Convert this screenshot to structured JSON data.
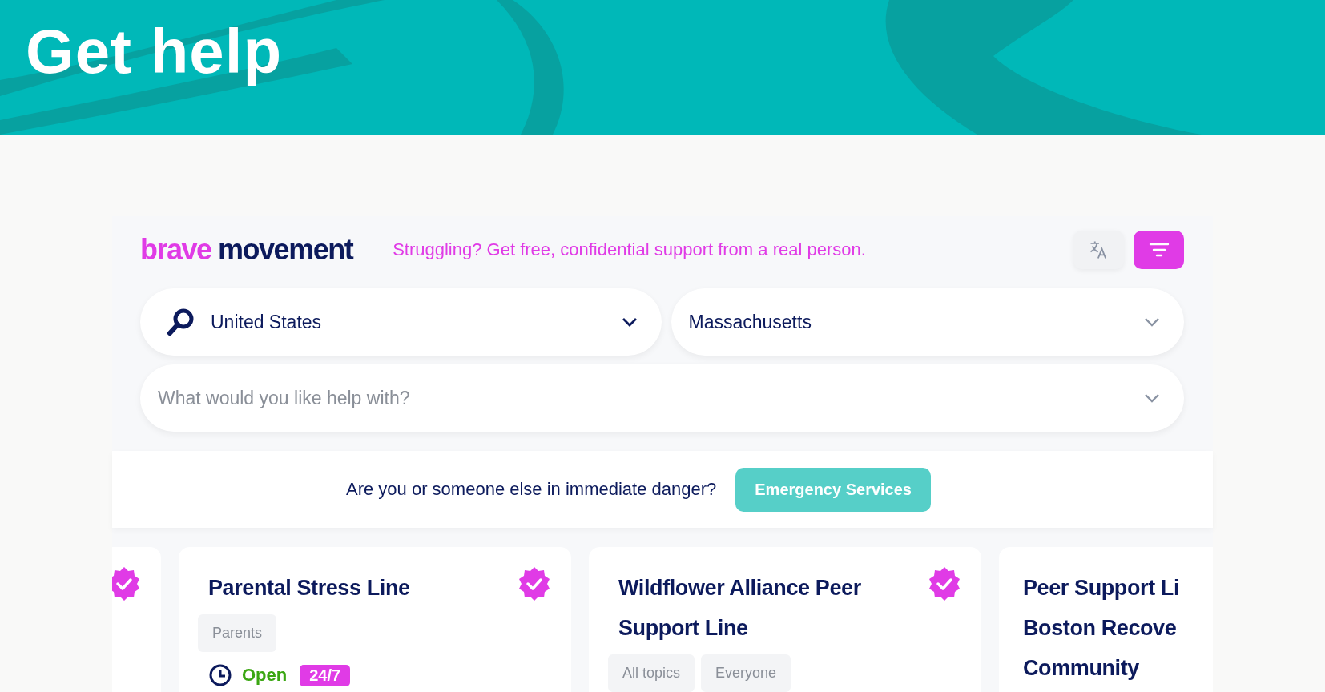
{
  "header": {
    "title": "Get help"
  },
  "widget": {
    "logo": {
      "part_1": "brave",
      "part_2": "movement"
    },
    "tagline": "Struggling? Get free, confidential support from a real person.",
    "country": {
      "value": "United States"
    },
    "region": {
      "value": "Massachusetts"
    },
    "topic": {
      "placeholder": "What would you like help with?"
    },
    "danger": {
      "question": "Are you or someone else in immediate danger?",
      "button": "Emergency Services"
    },
    "cards": [
      {
        "verified": true
      },
      {
        "verified": true,
        "title_lines": [
          "Parental Stress Line"
        ],
        "tags": [
          "Parents"
        ],
        "status": "Open",
        "hours": "24/7"
      },
      {
        "verified": true,
        "title_lines": [
          "Wildflower Alliance Peer",
          "Support Line"
        ],
        "tags": [
          "All topics",
          "Everyone"
        ]
      },
      {
        "title_lines": [
          "Peer Support Li",
          "Boston Recove",
          "Community"
        ]
      }
    ]
  }
}
